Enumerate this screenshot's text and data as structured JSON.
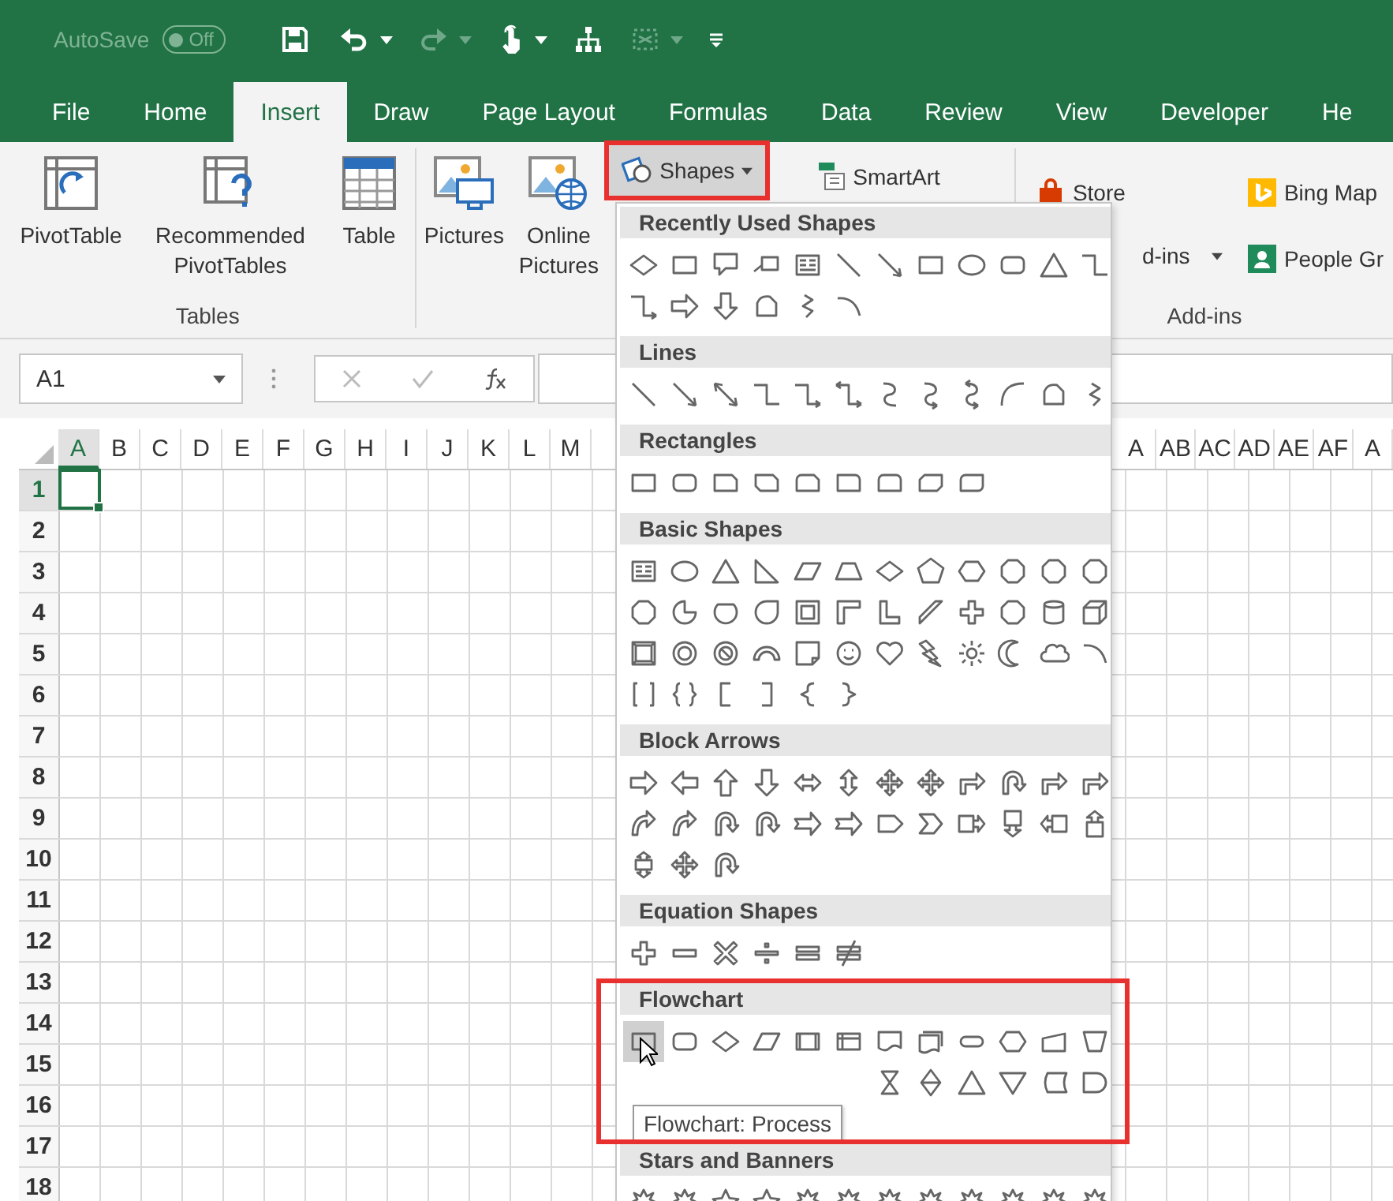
{
  "title_bar": {
    "autosave_label": "AutoSave",
    "autosave_toggle": {
      "label": "Off",
      "on": false
    }
  },
  "tabs": [
    {
      "label": "File",
      "selected": false
    },
    {
      "label": "Home",
      "selected": false
    },
    {
      "label": "Insert",
      "selected": true
    },
    {
      "label": "Draw",
      "selected": false
    },
    {
      "label": "Page Layout",
      "selected": false
    },
    {
      "label": "Formulas",
      "selected": false
    },
    {
      "label": "Data",
      "selected": false
    },
    {
      "label": "Review",
      "selected": false
    },
    {
      "label": "View",
      "selected": false
    },
    {
      "label": "Developer",
      "selected": false
    },
    {
      "label": "He",
      "selected": false
    }
  ],
  "ribbon": {
    "tables_group": {
      "label": "Tables",
      "buttons": [
        {
          "kind": "pivot",
          "label": "PivotTable"
        },
        {
          "kind": "recommended",
          "label": "Recommended PivotTables"
        },
        {
          "kind": "table",
          "label": "Table"
        }
      ]
    },
    "illustrations": {
      "large": [
        {
          "kind": "pictures",
          "label": "Pictures"
        },
        {
          "kind": "online",
          "label": "Online Pictures"
        }
      ],
      "small": [
        {
          "kind": "shapes",
          "label": "Shapes",
          "highlighted": true
        },
        {
          "kind": "smartart",
          "label": "SmartArt",
          "highlighted": false
        }
      ]
    },
    "addins_group": {
      "label": "Add-ins",
      "columns": [
        [
          {
            "kind": "store",
            "label": "Store"
          },
          {
            "kind": "myaddins",
            "label": "d-ins"
          }
        ],
        [
          {
            "kind": "bing",
            "label": "Bing Map"
          },
          {
            "kind": "people",
            "label": "People Gr"
          }
        ]
      ]
    }
  },
  "formula_bar": {
    "name_box": "A1"
  },
  "sheet": {
    "columns_left": [
      {
        "label": "A",
        "active": true
      },
      {
        "label": "B",
        "active": false
      },
      {
        "label": "C",
        "active": false
      },
      {
        "label": "D",
        "active": false
      },
      {
        "label": "E",
        "active": false
      },
      {
        "label": "F",
        "active": false
      },
      {
        "label": "G",
        "active": false
      },
      {
        "label": "H",
        "active": false
      },
      {
        "label": "I",
        "active": false
      },
      {
        "label": "J",
        "active": false
      },
      {
        "label": "K",
        "active": false
      },
      {
        "label": "L",
        "active": false
      },
      {
        "label": "M",
        "active": false
      }
    ],
    "columns_right": [
      "A",
      "AB",
      "AC",
      "AD",
      "AE",
      "AF",
      "A"
    ],
    "rows": [
      {
        "label": "1",
        "active": true
      },
      {
        "label": "2",
        "active": false
      },
      {
        "label": "3",
        "active": false
      },
      {
        "label": "4",
        "active": false
      },
      {
        "label": "5",
        "active": false
      },
      {
        "label": "6",
        "active": false
      },
      {
        "label": "7",
        "active": false
      },
      {
        "label": "8",
        "active": false
      },
      {
        "label": "9",
        "active": false
      },
      {
        "label": "10",
        "active": false
      },
      {
        "label": "11",
        "active": false
      },
      {
        "label": "12",
        "active": false
      },
      {
        "label": "13",
        "active": false
      },
      {
        "label": "14",
        "active": false
      },
      {
        "label": "15",
        "active": false
      },
      {
        "label": "16",
        "active": false
      },
      {
        "label": "17",
        "active": false
      },
      {
        "label": "18",
        "active": false
      }
    ]
  },
  "shape_menu": {
    "sections": [
      {
        "title": "Recently Used Shapes",
        "highlighted": false,
        "rows": [
          [
            {
              "kind": "diamond"
            },
            {
              "kind": "rect"
            },
            {
              "kind": "callout"
            },
            {
              "kind": "callout2"
            },
            {
              "kind": "textbox"
            },
            {
              "kind": "line"
            },
            {
              "kind": "arrowline"
            },
            {
              "kind": "rect"
            },
            {
              "kind": "oval"
            },
            {
              "kind": "roundrect"
            },
            {
              "kind": "triangle"
            },
            {
              "kind": "elbow"
            }
          ],
          [
            {
              "kind": "elbowarrow"
            },
            {
              "kind": "arrowR"
            },
            {
              "kind": "arrowD"
            },
            {
              "kind": "freeform"
            },
            {
              "kind": "scribble"
            },
            {
              "kind": "arc"
            }
          ]
        ]
      },
      {
        "title": "Lines",
        "highlighted": false,
        "rows": [
          [
            {
              "kind": "line"
            },
            {
              "kind": "arrowline"
            },
            {
              "kind": "dblarrow"
            },
            {
              "kind": "elbow"
            },
            {
              "kind": "elbowarrow"
            },
            {
              "kind": "elbowdbl"
            },
            {
              "kind": "scurve"
            },
            {
              "kind": "scurvearrow"
            },
            {
              "kind": "scurvedbl"
            },
            {
              "kind": "curve"
            },
            {
              "kind": "freeform"
            },
            {
              "kind": "scribble"
            }
          ]
        ]
      },
      {
        "title": "Rectangles",
        "highlighted": false,
        "rows": [
          [
            {
              "kind": "rect"
            },
            {
              "kind": "roundrect"
            },
            {
              "kind": "snip1"
            },
            {
              "kind": "snip2"
            },
            {
              "kind": "snipround"
            },
            {
              "kind": "round1"
            },
            {
              "kind": "roundtop"
            },
            {
              "kind": "snipdiag"
            },
            {
              "kind": "rounddiag"
            }
          ]
        ]
      },
      {
        "title": "Basic Shapes",
        "highlighted": false,
        "rows": [
          [
            {
              "kind": "textbox"
            },
            {
              "kind": "oval"
            },
            {
              "kind": "triangle"
            },
            {
              "kind": "rtriangle"
            },
            {
              "kind": "parallelogram"
            },
            {
              "kind": "trapezoid"
            },
            {
              "kind": "diamond"
            },
            {
              "kind": "pentagon"
            },
            {
              "kind": "hexagon"
            },
            {
              "kind": "octagon"
            },
            {
              "kind": "octagon"
            },
            {
              "kind": "octagon"
            }
          ],
          [
            {
              "kind": "octagon"
            },
            {
              "kind": "pie"
            },
            {
              "kind": "chord"
            },
            {
              "kind": "teardrop"
            },
            {
              "kind": "frame"
            },
            {
              "kind": "corner"
            },
            {
              "kind": "lshape"
            },
            {
              "kind": "diagstripe"
            },
            {
              "kind": "plus"
            },
            {
              "kind": "octagon"
            },
            {
              "kind": "cylinder"
            },
            {
              "kind": "cube"
            }
          ],
          [
            {
              "kind": "bevel"
            },
            {
              "kind": "donut"
            },
            {
              "kind": "nosign"
            },
            {
              "kind": "blockarc"
            },
            {
              "kind": "foldedcorner"
            },
            {
              "kind": "smiley"
            },
            {
              "kind": "heart"
            },
            {
              "kind": "lightning"
            },
            {
              "kind": "sun"
            },
            {
              "kind": "moon"
            },
            {
              "kind": "cloud"
            },
            {
              "kind": "arc"
            }
          ],
          [
            {
              "kind": "bracketpair"
            },
            {
              "kind": "bracepair"
            },
            {
              "kind": "lbracket"
            },
            {
              "kind": "rbracket"
            },
            {
              "kind": "lbrace"
            },
            {
              "kind": "rbrace"
            }
          ]
        ]
      },
      {
        "title": "Block Arrows",
        "highlighted": false,
        "rows": [
          [
            {
              "kind": "arrowR"
            },
            {
              "kind": "arrowL"
            },
            {
              "kind": "arrowU"
            },
            {
              "kind": "arrowD"
            },
            {
              "kind": "arrowLR"
            },
            {
              "kind": "arrowUD"
            },
            {
              "kind": "quad"
            },
            {
              "kind": "quad"
            },
            {
              "kind": "bentarrow"
            },
            {
              "kind": "uturn"
            },
            {
              "kind": "bentarrow"
            },
            {
              "kind": "bentarrow"
            }
          ],
          [
            {
              "kind": "curvedR"
            },
            {
              "kind": "curvedR"
            },
            {
              "kind": "uturn"
            },
            {
              "kind": "uturn"
            },
            {
              "kind": "notched"
            },
            {
              "kind": "notched"
            },
            {
              "kind": "pentarrow"
            },
            {
              "kind": "chevron"
            },
            {
              "kind": "calloutR"
            },
            {
              "kind": "calloutD"
            },
            {
              "kind": "calloutL"
            },
            {
              "kind": "calloutU"
            }
          ],
          [
            {
              "kind": "calloutUD"
            },
            {
              "kind": "quad"
            },
            {
              "kind": "uturn"
            }
          ]
        ]
      },
      {
        "title": "Equation Shapes",
        "highlighted": false,
        "rows": [
          [
            {
              "kind": "plus"
            },
            {
              "kind": "minus"
            },
            {
              "kind": "times"
            },
            {
              "kind": "divide"
            },
            {
              "kind": "equal"
            },
            {
              "kind": "notequal"
            }
          ]
        ]
      },
      {
        "title": "Flowchart",
        "highlighted": true,
        "tooltip": "Flowchart: Process",
        "rows": [
          [
            {
              "kind": "rect",
              "hovered": true
            },
            {
              "kind": "roundrect"
            },
            {
              "kind": "diamond"
            },
            {
              "kind": "parallelogram"
            },
            {
              "kind": "predefined"
            },
            {
              "kind": "internalstorage"
            },
            {
              "kind": "document"
            },
            {
              "kind": "multidoc"
            },
            {
              "kind": "terminator"
            },
            {
              "kind": "hexagon"
            },
            {
              "kind": "manualinput"
            },
            {
              "kind": "manualop"
            }
          ],
          [
            null,
            null,
            null,
            null,
            null,
            null,
            {
              "kind": "hourglass"
            },
            {
              "kind": "sort"
            },
            {
              "kind": "triangle"
            },
            {
              "kind": "merge"
            },
            {
              "kind": "storeddata"
            },
            {
              "kind": "delay"
            }
          ]
        ]
      },
      {
        "title": "Stars and Banners",
        "highlighted": false,
        "rows": [
          [
            {
              "kind": "seal"
            },
            {
              "kind": "seal"
            },
            {
              "kind": "star"
            },
            {
              "kind": "star"
            },
            {
              "kind": "seal"
            },
            {
              "kind": "seal"
            },
            {
              "kind": "seal"
            },
            {
              "kind": "seal"
            },
            {
              "kind": "seal"
            },
            {
              "kind": "seal"
            },
            {
              "kind": "seal"
            },
            {
              "kind": "seal"
            }
          ]
        ]
      }
    ]
  }
}
